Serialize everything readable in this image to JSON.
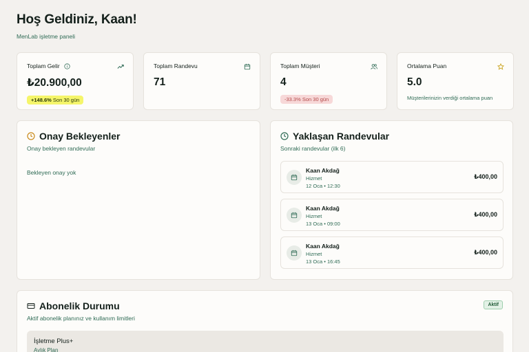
{
  "header": {
    "greeting": "Hoş Geldiniz, Kaan!",
    "subtitle": "MenLab işletme paneli"
  },
  "stats": [
    {
      "label": "Toplam Gelir",
      "value": "₺20.900,00",
      "change": "+148.6%",
      "period": "Son 30 gün",
      "trend": "up",
      "icon": "trending-up-icon"
    },
    {
      "label": "Toplam Randevu",
      "value": "71",
      "icon": "calendar-icon"
    },
    {
      "label": "Toplam Müşteri",
      "value": "4",
      "change": "-33.3%",
      "period": "Son 30 gün",
      "trend": "down",
      "icon": "users-icon"
    },
    {
      "label": "Ortalama Puan",
      "value": "5.0",
      "note": "Müşterilerinizin verdiği ortalama puan",
      "icon": "star-icon"
    }
  ],
  "pending": {
    "title": "Onay Bekleyenler",
    "subtitle": "Onay bekleyen randevular",
    "empty": "Bekleyen onay yok"
  },
  "upcoming": {
    "title": "Yaklaşan Randevular",
    "subtitle": "Sonraki randevular (ilk 6)",
    "items": [
      {
        "name": "Kaan Akdağ",
        "service": "Hizmet",
        "time": "12 Oca • 12:30",
        "price": "₺400,00"
      },
      {
        "name": "Kaan Akdağ",
        "service": "Hizmet",
        "time": "13 Oca • 09:00",
        "price": "₺400,00"
      },
      {
        "name": "Kaan Akdağ",
        "service": "Hizmet",
        "time": "13 Oca • 16:45",
        "price": "₺400,00"
      }
    ]
  },
  "subscription": {
    "title": "Abonelik Durumu",
    "subtitle": "Aktif abonelik planınız ve kullanım limitleri",
    "status": "Aktif",
    "plan_name": "İşletme Plus+",
    "plan_type": "Aylık Plan"
  },
  "colors": {
    "background": "#f3f1ee",
    "accent_green": "#2f6b55",
    "pending_icon": "#c98a1a",
    "positive_pill": "#f5f56a",
    "negative_pill": "#f7d8d8"
  }
}
